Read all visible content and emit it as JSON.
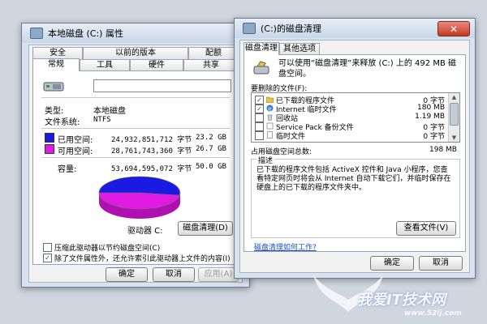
{
  "properties_window": {
    "title": "本地磁盘 (C:) 属性",
    "tabs_top": [
      "安全",
      "以前的版本",
      "配额"
    ],
    "tabs_bottom": [
      "常规",
      "工具",
      "硬件",
      "共享"
    ],
    "type_label": "类型:",
    "type_value": "本地磁盘",
    "fs_label": "文件系统:",
    "fs_value": "NTFS",
    "used": {
      "label": "已用空间:",
      "bytes": "24,932,851,712 字节",
      "size": "23.2 GB",
      "color": "#1a1ae0"
    },
    "free": {
      "label": "可用空间:",
      "bytes": "28,761,743,360 字节",
      "size": "26.7 GB",
      "color": "#e01ae0"
    },
    "capacity": {
      "label": "容量:",
      "bytes": "53,694,595,072 字节",
      "size": "50.0 GB"
    },
    "drive_label": "驱动器 C:",
    "cleanup_button": "磁盘清理(D)",
    "compress_label": "压缩此驱动器以节约磁盘空间(C)",
    "index_label": "除了文件属性外，还允许索引此驱动器上文件的内容(I)",
    "ok": "确定",
    "cancel": "取消",
    "apply": "应用(A)"
  },
  "cleanup_window": {
    "title": "(C:)的磁盘清理",
    "tabs": [
      "磁盘清理",
      "其他选项"
    ],
    "intro": "可以使用“磁盘清理”来释放 (C:) 上的 492 MB 磁盘空间。",
    "files_label": "要删除的文件(F):",
    "files": [
      {
        "name": "已下载的程序文件",
        "size": "0 字节",
        "checked": true,
        "icon": "folder-icon"
      },
      {
        "name": "Internet 临时文件",
        "size": "180 MB",
        "checked": true,
        "icon": "ie-icon"
      },
      {
        "name": "回收站",
        "size": "1.19 MB",
        "checked": false,
        "icon": "recycle-bin-icon"
      },
      {
        "name": "Service Pack 备份文件",
        "size": "0 字节",
        "checked": false,
        "icon": "backup-icon"
      },
      {
        "name": "临时文件",
        "size": "0 字节",
        "checked": false,
        "icon": "temp-file-icon"
      }
    ],
    "total_label": "占用磁盘空间总数:",
    "total_value": "198 MB",
    "description_label": "描述",
    "description": "已下载的程序文件包括 ActiveX 控件和 Java 小程序，您查看特定网页时将会从 Internet 自动下载它们，并临时保存在硬盘上的已下载的程序文件夹中。",
    "view_files_button": "查看文件(V)",
    "help_link": "磁盘清理如何工作?",
    "ok": "确定",
    "cancel": "取消"
  },
  "watermark": {
    "text": "我爱IT技术网",
    "url": "www.52ij.com"
  }
}
